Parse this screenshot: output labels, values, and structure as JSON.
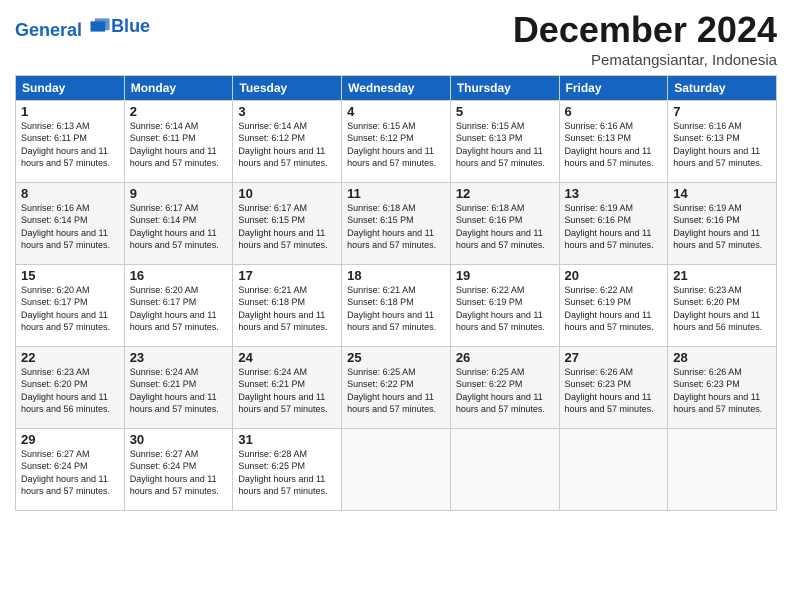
{
  "logo": {
    "line1": "General",
    "line2": "Blue"
  },
  "title": "December 2024",
  "subtitle": "Pematangsiantar, Indonesia",
  "days_header": [
    "Sunday",
    "Monday",
    "Tuesday",
    "Wednesday",
    "Thursday",
    "Friday",
    "Saturday"
  ],
  "weeks": [
    [
      {
        "day": "1",
        "sunrise": "6:13 AM",
        "sunset": "6:11 PM",
        "daylight": "11 hours and 57 minutes."
      },
      {
        "day": "2",
        "sunrise": "6:14 AM",
        "sunset": "6:11 PM",
        "daylight": "11 hours and 57 minutes."
      },
      {
        "day": "3",
        "sunrise": "6:14 AM",
        "sunset": "6:12 PM",
        "daylight": "11 hours and 57 minutes."
      },
      {
        "day": "4",
        "sunrise": "6:15 AM",
        "sunset": "6:12 PM",
        "daylight": "11 hours and 57 minutes."
      },
      {
        "day": "5",
        "sunrise": "6:15 AM",
        "sunset": "6:13 PM",
        "daylight": "11 hours and 57 minutes."
      },
      {
        "day": "6",
        "sunrise": "6:16 AM",
        "sunset": "6:13 PM",
        "daylight": "11 hours and 57 minutes."
      },
      {
        "day": "7",
        "sunrise": "6:16 AM",
        "sunset": "6:13 PM",
        "daylight": "11 hours and 57 minutes."
      }
    ],
    [
      {
        "day": "8",
        "sunrise": "6:16 AM",
        "sunset": "6:14 PM",
        "daylight": "11 hours and 57 minutes."
      },
      {
        "day": "9",
        "sunrise": "6:17 AM",
        "sunset": "6:14 PM",
        "daylight": "11 hours and 57 minutes."
      },
      {
        "day": "10",
        "sunrise": "6:17 AM",
        "sunset": "6:15 PM",
        "daylight": "11 hours and 57 minutes."
      },
      {
        "day": "11",
        "sunrise": "6:18 AM",
        "sunset": "6:15 PM",
        "daylight": "11 hours and 57 minutes."
      },
      {
        "day": "12",
        "sunrise": "6:18 AM",
        "sunset": "6:16 PM",
        "daylight": "11 hours and 57 minutes."
      },
      {
        "day": "13",
        "sunrise": "6:19 AM",
        "sunset": "6:16 PM",
        "daylight": "11 hours and 57 minutes."
      },
      {
        "day": "14",
        "sunrise": "6:19 AM",
        "sunset": "6:16 PM",
        "daylight": "11 hours and 57 minutes."
      }
    ],
    [
      {
        "day": "15",
        "sunrise": "6:20 AM",
        "sunset": "6:17 PM",
        "daylight": "11 hours and 57 minutes."
      },
      {
        "day": "16",
        "sunrise": "6:20 AM",
        "sunset": "6:17 PM",
        "daylight": "11 hours and 57 minutes."
      },
      {
        "day": "17",
        "sunrise": "6:21 AM",
        "sunset": "6:18 PM",
        "daylight": "11 hours and 57 minutes."
      },
      {
        "day": "18",
        "sunrise": "6:21 AM",
        "sunset": "6:18 PM",
        "daylight": "11 hours and 57 minutes."
      },
      {
        "day": "19",
        "sunrise": "6:22 AM",
        "sunset": "6:19 PM",
        "daylight": "11 hours and 57 minutes."
      },
      {
        "day": "20",
        "sunrise": "6:22 AM",
        "sunset": "6:19 PM",
        "daylight": "11 hours and 57 minutes."
      },
      {
        "day": "21",
        "sunrise": "6:23 AM",
        "sunset": "6:20 PM",
        "daylight": "11 hours and 56 minutes."
      }
    ],
    [
      {
        "day": "22",
        "sunrise": "6:23 AM",
        "sunset": "6:20 PM",
        "daylight": "11 hours and 56 minutes."
      },
      {
        "day": "23",
        "sunrise": "6:24 AM",
        "sunset": "6:21 PM",
        "daylight": "11 hours and 57 minutes."
      },
      {
        "day": "24",
        "sunrise": "6:24 AM",
        "sunset": "6:21 PM",
        "daylight": "11 hours and 57 minutes."
      },
      {
        "day": "25",
        "sunrise": "6:25 AM",
        "sunset": "6:22 PM",
        "daylight": "11 hours and 57 minutes."
      },
      {
        "day": "26",
        "sunrise": "6:25 AM",
        "sunset": "6:22 PM",
        "daylight": "11 hours and 57 minutes."
      },
      {
        "day": "27",
        "sunrise": "6:26 AM",
        "sunset": "6:23 PM",
        "daylight": "11 hours and 57 minutes."
      },
      {
        "day": "28",
        "sunrise": "6:26 AM",
        "sunset": "6:23 PM",
        "daylight": "11 hours and 57 minutes."
      }
    ],
    [
      {
        "day": "29",
        "sunrise": "6:27 AM",
        "sunset": "6:24 PM",
        "daylight": "11 hours and 57 minutes."
      },
      {
        "day": "30",
        "sunrise": "6:27 AM",
        "sunset": "6:24 PM",
        "daylight": "11 hours and 57 minutes."
      },
      {
        "day": "31",
        "sunrise": "6:28 AM",
        "sunset": "6:25 PM",
        "daylight": "11 hours and 57 minutes."
      },
      null,
      null,
      null,
      null
    ]
  ]
}
